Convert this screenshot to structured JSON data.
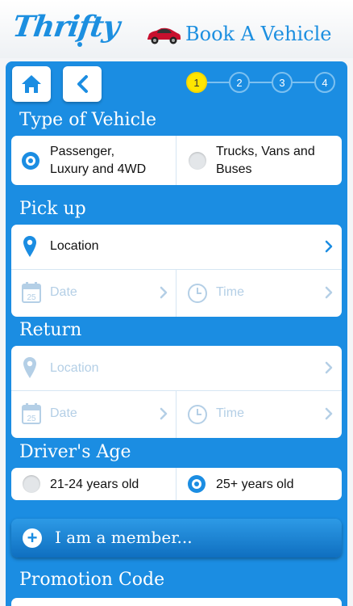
{
  "header": {
    "logo_text": "Thrifty",
    "title": "Book A Vehicle"
  },
  "nav": {
    "home_icon": "home-icon",
    "back_icon": "back-chevron-icon"
  },
  "steps": [
    {
      "label": "1",
      "active": true
    },
    {
      "label": "2",
      "active": false
    },
    {
      "label": "3",
      "active": false
    },
    {
      "label": "4",
      "active": false
    }
  ],
  "vehicle_type": {
    "title": "Type of Vehicle",
    "options": [
      {
        "line1": "Passenger,",
        "line2": "Luxury and 4WD",
        "selected": true
      },
      {
        "line1": "Trucks, Vans and",
        "line2": "Buses",
        "selected": false
      }
    ]
  },
  "pickup": {
    "title": "Pick up",
    "location": "Location",
    "date": "Date",
    "time": "Time",
    "calendar_day": "25"
  },
  "return": {
    "title": "Return",
    "location": "Location",
    "date": "Date",
    "time": "Time",
    "calendar_day": "25"
  },
  "drivers_age": {
    "title": "Driver's Age",
    "options": [
      {
        "label": "21-24 years old",
        "selected": false
      },
      {
        "label": "25+ years old",
        "selected": true
      }
    ]
  },
  "member": {
    "label": "I am a member..."
  },
  "promotion": {
    "title": "Promotion Code"
  },
  "colors": {
    "brand_blue": "#1b8de2",
    "step_active": "#ffe600",
    "car_red": "#c8102e"
  }
}
